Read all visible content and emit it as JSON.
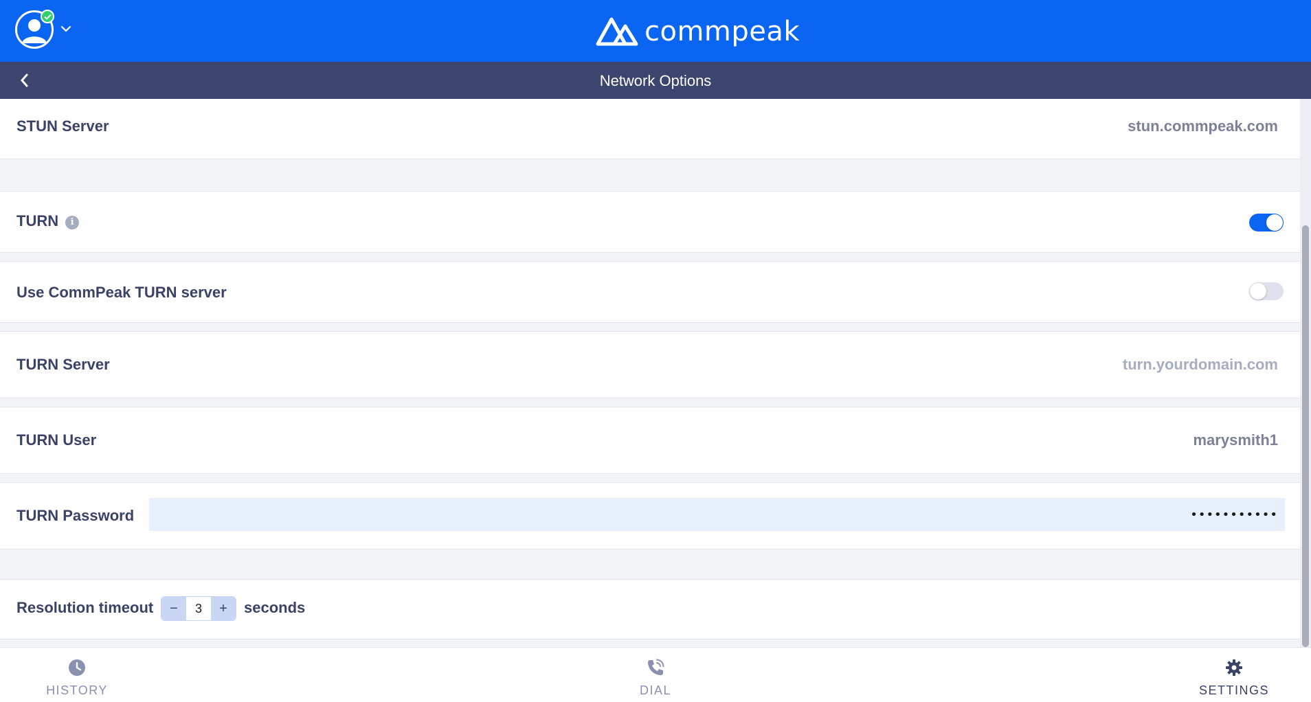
{
  "header": {
    "brand": "commpeak",
    "status": "online",
    "colors": {
      "brand_blue": "#0a66f2",
      "title_bar": "#3c456d",
      "status_green": "#2fd06d"
    }
  },
  "titlebar": {
    "title": "Network Options"
  },
  "settings": {
    "stun_server": {
      "label": "STUN Server",
      "value": "stun.commpeak.com"
    },
    "turn": {
      "label": "TURN",
      "enabled": true
    },
    "use_commpeak_turn": {
      "label": "Use CommPeak TURN server",
      "enabled": false
    },
    "turn_server": {
      "label": "TURN Server",
      "placeholder": "turn.yourdomain.com"
    },
    "turn_user": {
      "label": "TURN User",
      "value": "marysmith1"
    },
    "turn_password": {
      "label": "TURN Password",
      "value": "•••••••••••"
    },
    "resolution_timeout": {
      "label": "Resolution timeout",
      "value": "3",
      "decrement": "−",
      "increment": "+",
      "unit": "seconds"
    }
  },
  "nav": {
    "items": [
      {
        "label": "HISTORY",
        "icon": "clock-icon",
        "active": false
      },
      {
        "label": "DIAL",
        "icon": "phone-icon",
        "active": false
      },
      {
        "label": "SETTINGS",
        "icon": "gear-icon",
        "active": true
      }
    ]
  }
}
